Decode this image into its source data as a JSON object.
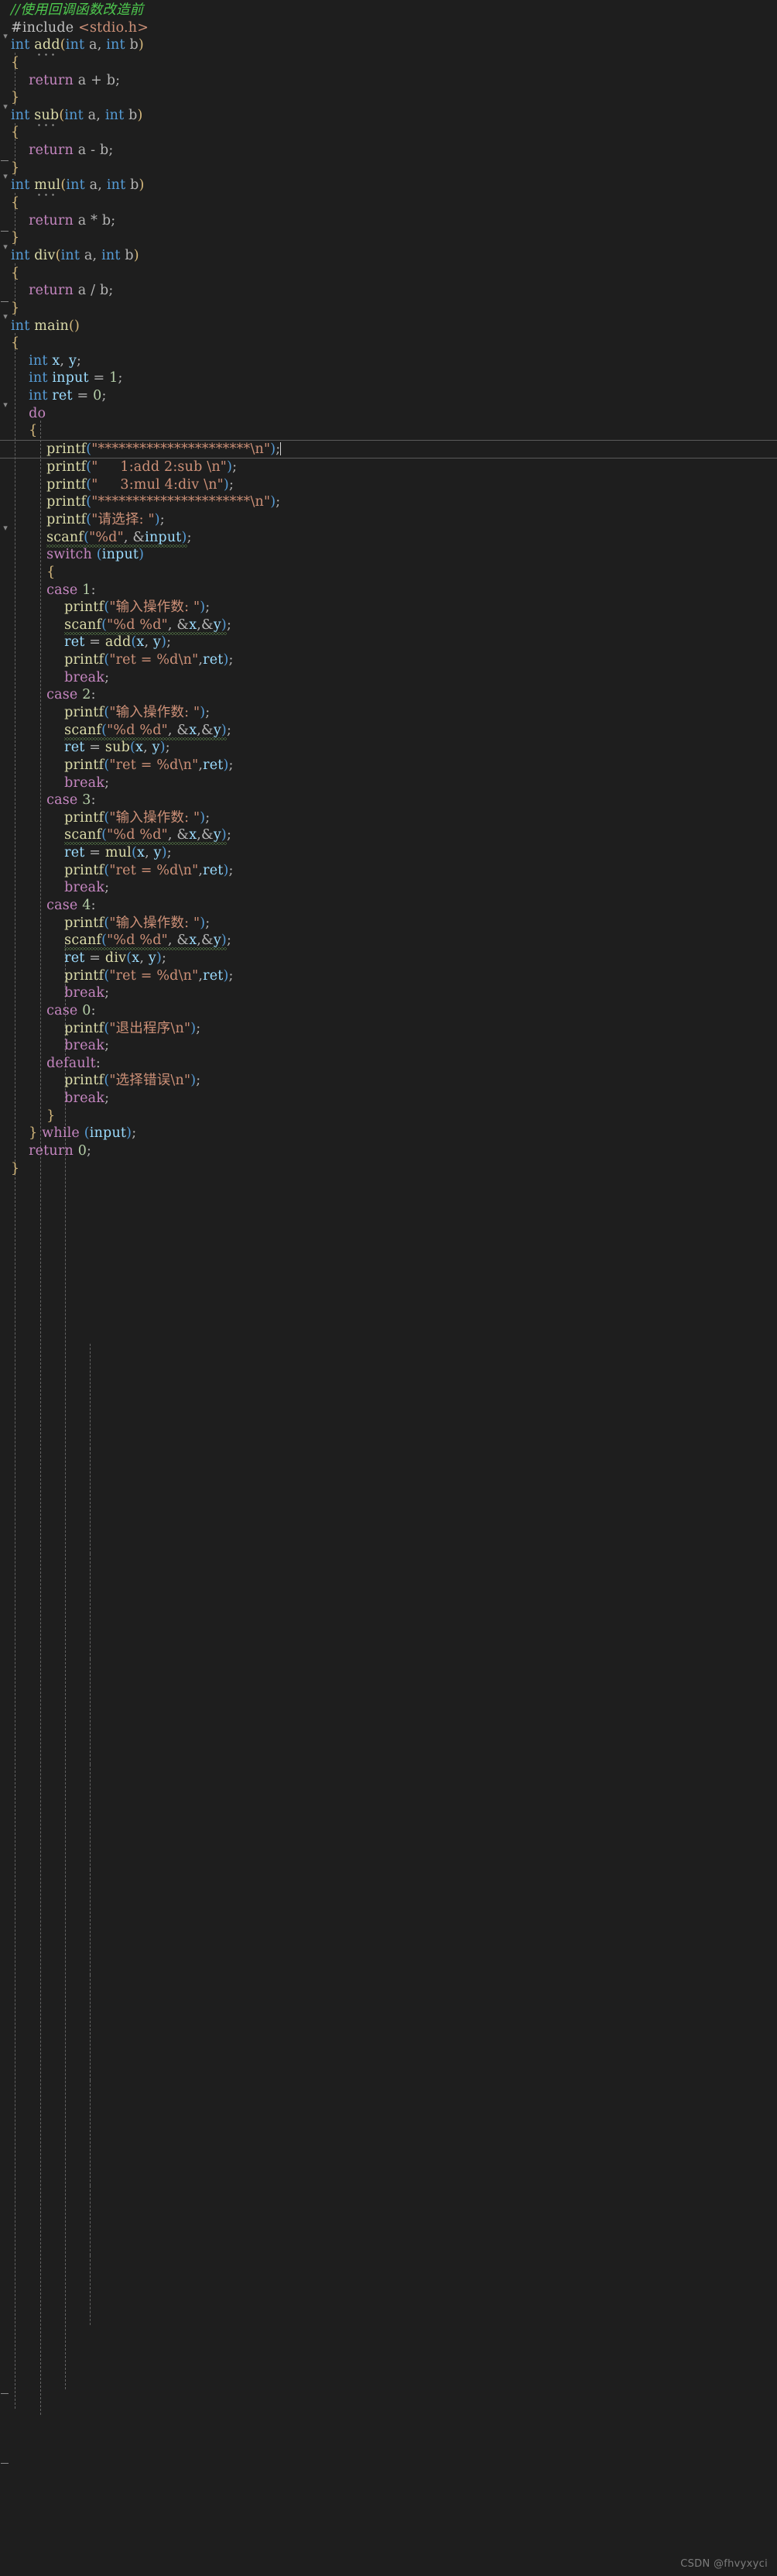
{
  "editor": {
    "language": "c",
    "theme_background": "#1e1e1e",
    "colors": {
      "background": "#1e1e1e",
      "comment": "#4ec94e",
      "keyword": "#569cd6",
      "control_keyword": "#c586c0",
      "function": "#dcdcaa",
      "string": "#ce9178",
      "number": "#b5cea8",
      "variable": "#9cdcfe",
      "punctuation": "#b4b4b4",
      "indent_guide": "#707070",
      "current_line_border": "#5a5a5a",
      "squiggle_error": "#6a9955"
    },
    "current_line_number": 28,
    "cursor_visible": true
  },
  "watermark": {
    "text": "CSDN @fhvyxyci"
  },
  "code": {
    "lines": [
      "//使用回调函数改造前",
      "#include <stdio.h>",
      "int add(int a, int b)",
      "{",
      "    return a + b;",
      "}",
      "int sub(int a, int b)",
      "{",
      "    return a - b;",
      "}",
      "int mul(int a, int b)",
      "{",
      "    return a * b;",
      "}",
      "int div(int a, int b)",
      "{",
      "    return a / b;",
      "}",
      "int main()",
      "{",
      "    int x, y;",
      "    int input = 1;",
      "    int ret = 0;",
      "    do",
      "    {",
      "        printf(\"**********************\\n\");",
      "        printf(\"     1:add 2:sub \\n\");",
      "        printf(\"     3:mul 4:div \\n\");",
      "        printf(\"**********************\\n\");",
      "        printf(\"请选择: \");",
      "        scanf(\"%d\", &input);",
      "        switch (input)",
      "        {",
      "        case 1:",
      "            printf(\"输入操作数: \");",
      "            scanf(\"%d %d\", &x,&y);",
      "            ret = add(x, y);",
      "            printf(\"ret = %d\\n\",ret);",
      "            break;",
      "        case 2:",
      "            printf(\"输入操作数: \");",
      "            scanf(\"%d %d\", &x,&y);",
      "            ret = sub(x, y);",
      "            printf(\"ret = %d\\n\",ret);",
      "            break;",
      "        case 3:",
      "            printf(\"输入操作数: \");",
      "            scanf(\"%d %d\", &x,&y);",
      "            ret = mul(x, y);",
      "            printf(\"ret = %d\\n\",ret);",
      "            break;",
      "        case 4:",
      "            printf(\"输入操作数: \");",
      "            scanf(\"%d %d\", &x,&y);",
      "            ret = div(x, y);",
      "            printf(\"ret = %d\\n\",ret);",
      "            break;",
      "        case 0:",
      "            printf(\"退出程序\\n\");",
      "            break;",
      "        default:",
      "            printf(\"选择错误\\n\");",
      "            break;",
      "        }",
      "    } while (input);",
      "    return 0;",
      "}"
    ],
    "tokens": {
      "comment_header": "//使用回调函数改造前",
      "include_directive": "#include",
      "include_header": "<stdio.h>",
      "keyword_int": "int",
      "keyword_return": "return",
      "keyword_do": "do",
      "keyword_while": "while",
      "keyword_switch": "switch",
      "keyword_case": "case",
      "keyword_break": "break",
      "keyword_default": "default",
      "fn_add": "add",
      "fn_sub": "sub",
      "fn_mul": "mul",
      "fn_div": "div",
      "fn_main": "main",
      "fn_printf": "printf",
      "fn_scanf": "scanf",
      "var_a": "a",
      "var_b": "b",
      "var_x": "x",
      "var_y": "y",
      "var_input": "input",
      "var_ret": "ret",
      "str_banner": "\"**********************\\n\"",
      "str_menu1": "\"     1:add 2:sub \\n\"",
      "str_menu2": "\"     3:mul 4:div \\n\"",
      "str_choose": "\"请选择: \"",
      "str_fmt_d": "\"%d\"",
      "str_fmt_dd": "\"%d %d\"",
      "str_operands": "\"输入操作数: \"",
      "str_ret": "\"ret = %d\\n\"",
      "str_exit": "\"退出程序\\n\"",
      "str_error": "\"选择错误\\n\"",
      "num_0": "0",
      "num_1": "1",
      "num_2": "2",
      "num_3": "3",
      "num_4": "4"
    }
  },
  "icons": {
    "fold_open": "⌄",
    "fold_end": "—"
  }
}
